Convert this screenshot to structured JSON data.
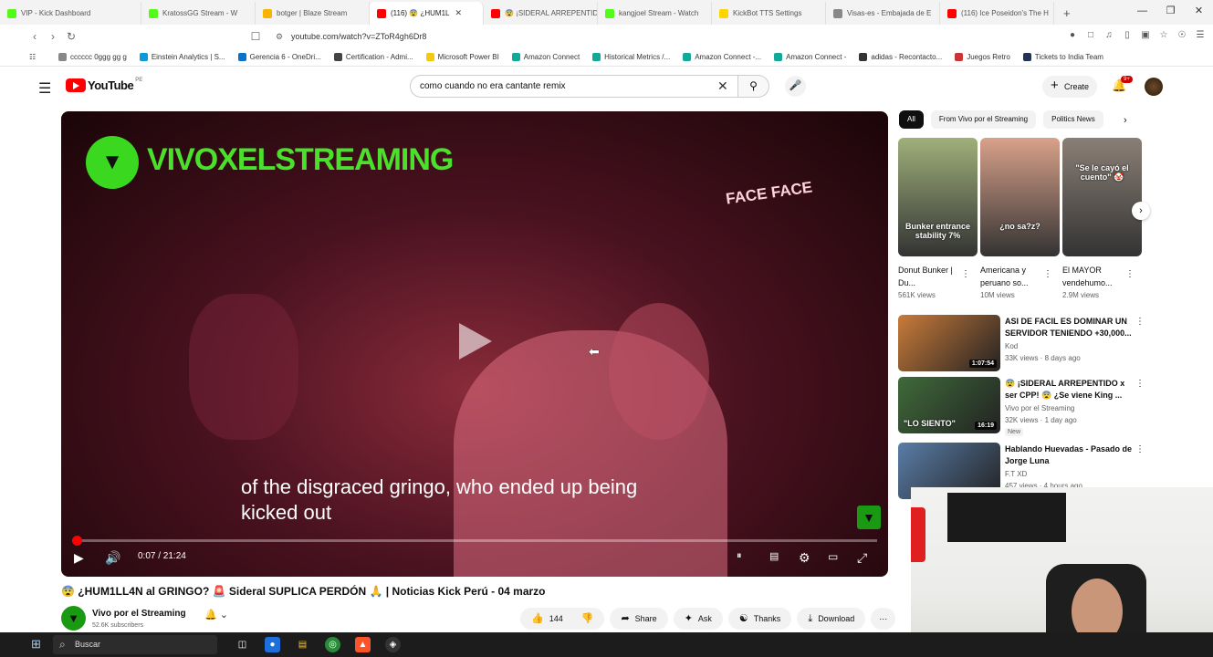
{
  "browser": {
    "tabs": [
      {
        "label": "VIP - Kick Dashboard",
        "color": "#53fc18"
      },
      {
        "label": "KratossGG Stream - W",
        "color": "#53fc18"
      },
      {
        "label": "botger | Blaze Stream",
        "color": "#f7b500"
      },
      {
        "label": "(116) 😨 ¿HUM1L",
        "color": "#ff0000",
        "active": true
      },
      {
        "label": "😨 ¡SIDERAL ARREPENTID",
        "color": "#ff0000"
      },
      {
        "label": "kangjoel Stream - Watch",
        "color": "#53fc18"
      },
      {
        "label": "KickBot TTS Settings",
        "color": "#ffd400"
      },
      {
        "label": "Visas-es - Embajada de E",
        "color": "#888888"
      },
      {
        "label": "(116) Ice Poseidon's The H",
        "color": "#ff0000"
      }
    ],
    "new_tab": "+",
    "url": "youtube.com/watch?v=ZToR4gh6Dr8",
    "bookmarks": [
      {
        "label": "cccccc 0ggg gg g",
        "color": "#888"
      },
      {
        "label": "Einstein Analytics | S...",
        "color": "#0a9ad8"
      },
      {
        "label": "Gerencia 6 - OneDri...",
        "color": "#0a72c8"
      },
      {
        "label": "Certification - Admi...",
        "color": "#444"
      },
      {
        "label": "Microsoft Power BI",
        "color": "#f2c811"
      },
      {
        "label": "Amazon Connect",
        "color": "#1a9"
      },
      {
        "label": "Historical Metrics /...",
        "color": "#1a9"
      },
      {
        "label": "Amazon Connect -...",
        "color": "#1a9"
      },
      {
        "label": "Amazon Connect -",
        "color": "#1a9"
      },
      {
        "label": "adidas - Recontacto...",
        "color": "#333"
      },
      {
        "label": "Juegos Retro",
        "color": "#c33"
      },
      {
        "label": "Tickets to India Team",
        "color": "#235"
      }
    ]
  },
  "youtube": {
    "logo_text": "YouTube",
    "region": "PE",
    "search_value": "como cuando no era cantante remix",
    "create_label": "Create",
    "notif_count": "9+",
    "video": {
      "channel_banner": "VIVOXELSTREAMING",
      "corner_text": "FACE FACE",
      "subtitle": "of the disgraced gringo, who ended up being kicked out",
      "time": "0:07 / 21:24",
      "progress": 0.0055,
      "title": "😨 ¿HUM1LL4N al GRINGO? 🚨 Sideral SUPLICA PERDÓN 🙏 | Noticias Kick Perú - 04 marzo"
    },
    "channel": {
      "name": "Vivo por el Streaming",
      "subs": "52.6K subscribers"
    },
    "actions": {
      "likes": "144",
      "share": "Share",
      "ask": "Ask",
      "thanks": "Thanks",
      "download": "Download"
    },
    "chips": [
      "All",
      "From Vivo por el Streaming",
      "Politics News"
    ],
    "shorts": [
      {
        "title": "Donut Bunker | Du...",
        "views": "561K views",
        "caption": "Bunker entrance stability 7%",
        "bg": "#9fb07a"
      },
      {
        "title": "Americana y peruano so...",
        "views": "10M views",
        "caption": "¿no sa?z?",
        "bg": "#d9a18a"
      },
      {
        "title": "El MAYOR vendehumo...",
        "views": "2.9M views",
        "caption": "\"Se le cayó el cuento\" 🤡",
        "bg": "#8a7f76"
      }
    ],
    "recommendations": [
      {
        "title": "ASI DE FACIL ES DOMINAR UN SERVIDOR TENIENDO +30,000...",
        "channel": "Kod",
        "meta": "33K views · 8 days ago",
        "duration": "1:07:54",
        "bg": "#c97b3a",
        "new": ""
      },
      {
        "title": "😨 ¡SIDERAL ARREPENTIDO x ser CPP! 😨 ¿Se viene King ...",
        "channel": "Vivo por el Streaming",
        "meta": "32K views · 1 day ago",
        "duration": "16:19",
        "bg": "#3f6a3a",
        "new": "New",
        "overlay": "\"LO SIENTO\""
      },
      {
        "title": "Hablando Huevadas - Pasado de Jorge Luna",
        "channel": "F.T XD",
        "meta": "457 views · 4 hours ago",
        "duration": "",
        "bg": "#5a7da8",
        "new": ""
      }
    ]
  },
  "taskbar": {
    "search_placeholder": "Buscar"
  }
}
